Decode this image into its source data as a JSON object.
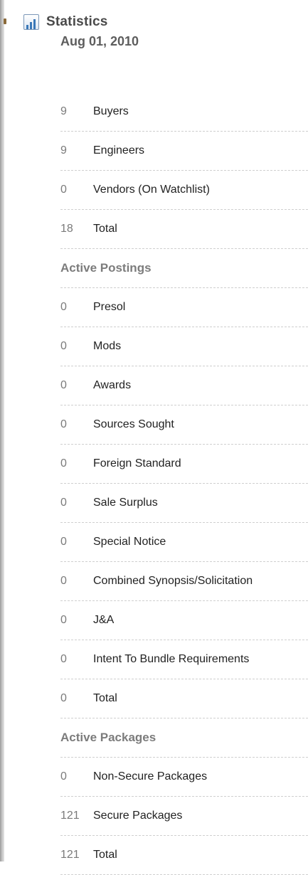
{
  "statistics": {
    "title": "Statistics",
    "icon": "bar-chart-icon",
    "date": "Aug 01, 2010",
    "rows": [
      {
        "kind": "item",
        "count": "9",
        "label": "Buyers"
      },
      {
        "kind": "item",
        "count": "9",
        "label": "Engineers"
      },
      {
        "kind": "item",
        "count": "0",
        "label": "Vendors (On Watchlist)"
      },
      {
        "kind": "item",
        "count": "18",
        "label": "Total"
      },
      {
        "kind": "section",
        "label": "Active Postings"
      },
      {
        "kind": "item",
        "count": "0",
        "label": "Presol"
      },
      {
        "kind": "item",
        "count": "0",
        "label": "Mods"
      },
      {
        "kind": "item",
        "count": "0",
        "label": "Awards"
      },
      {
        "kind": "item",
        "count": "0",
        "label": "Sources Sought"
      },
      {
        "kind": "item",
        "count": "0",
        "label": "Foreign Standard"
      },
      {
        "kind": "item",
        "count": "0",
        "label": "Sale Surplus"
      },
      {
        "kind": "item",
        "count": "0",
        "label": "Special Notice"
      },
      {
        "kind": "item",
        "count": "0",
        "label": "Combined Synopsis/Solicitation"
      },
      {
        "kind": "item",
        "count": "0",
        "label": "J&A"
      },
      {
        "kind": "item",
        "count": "0",
        "label": "Intent To Bundle Requirements"
      },
      {
        "kind": "item",
        "count": "0",
        "label": "Total"
      },
      {
        "kind": "section",
        "label": "Active Packages"
      },
      {
        "kind": "item",
        "count": "0",
        "label": "Non-Secure Packages"
      },
      {
        "kind": "item",
        "count": "121",
        "label": "Secure Packages"
      },
      {
        "kind": "item",
        "count": "121",
        "label": "Total"
      }
    ]
  }
}
